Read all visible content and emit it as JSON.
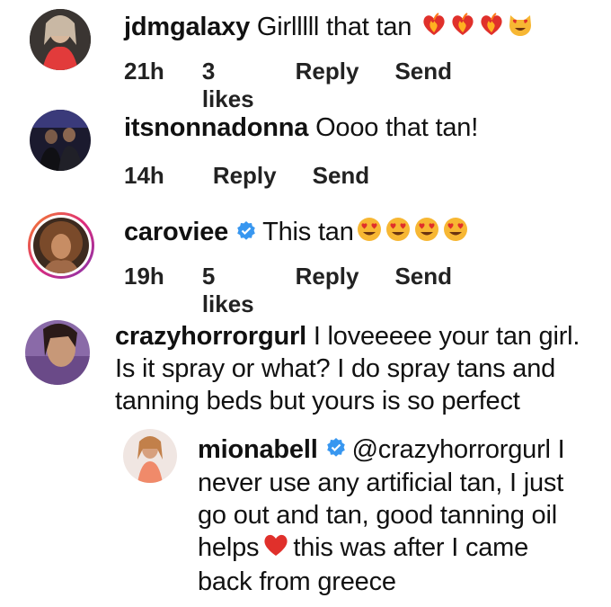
{
  "comments": [
    {
      "username": "jdmgalaxy",
      "text": "Girlllll that tan",
      "emojis": [
        "heart-fire-icon",
        "heart-fire-icon",
        "heart-fire-icon",
        "heart-eyes-cat-icon"
      ],
      "time": "21h",
      "likes": "3 likes",
      "reply": "Reply",
      "send": "Send"
    },
    {
      "username": "itsnonnadonna",
      "text": "Oooo that tan!",
      "time": "14h",
      "reply": "Reply",
      "send": "Send"
    },
    {
      "username": "caroviee",
      "verified": true,
      "text": "This tan",
      "emojis": [
        "heart-eyes-icon",
        "heart-eyes-icon",
        "heart-eyes-icon",
        "heart-eyes-icon"
      ],
      "time": "19h",
      "likes": "5 likes",
      "reply": "Reply",
      "send": "Send"
    },
    {
      "username": "crazyhorrorgurl",
      "lines": [
        "I loveeeee your tan girl.",
        "Is it spray or what? I do spray tans and",
        "tanning beds but yours is so perfect"
      ]
    },
    {
      "username": "mionabell",
      "verified": true,
      "mention": "@crazyhorrorgurl I",
      "lines": [
        "never use any artificial tan, I just",
        "go out and tan, good tanning oil"
      ],
      "line4a": "helps",
      "line4b": "this was after I came",
      "line5": "back from greece"
    }
  ],
  "colors": {
    "verified": "#3897f0",
    "heart": "#e0302b",
    "story_ring_start": "#f58529",
    "story_ring_end": "#dd2a7b"
  }
}
